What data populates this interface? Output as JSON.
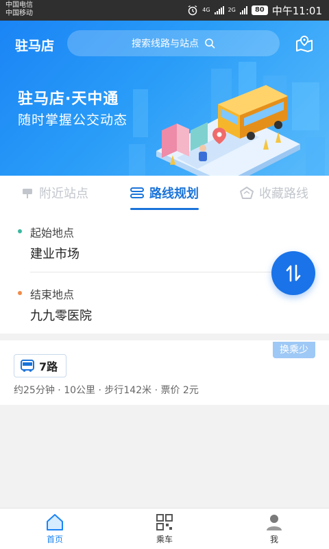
{
  "status_bar": {
    "carrier1": "中国电信",
    "carrier2": "中国移动",
    "signal1": "4G",
    "signal2": "2G",
    "battery": "80",
    "time": "中午11:01"
  },
  "header": {
    "city": "驻马店",
    "search_placeholder": "搜索线路与站点"
  },
  "hero": {
    "slogan_title": "驻马店·天中通",
    "slogan_subtitle": "随时掌握公交动态"
  },
  "tabs": [
    {
      "label": "附近站点",
      "icon": "signboard-icon"
    },
    {
      "label": "路线规划",
      "icon": "route-icon"
    },
    {
      "label": "收藏路线",
      "icon": "star-icon"
    }
  ],
  "route_form": {
    "start_label": "起始地点",
    "start_value": "建业市场",
    "end_label": "结束地点",
    "end_value": "九九零医院",
    "start_dot_color": "#3bb7a0",
    "end_dot_color": "#f08a48"
  },
  "result": {
    "tag": "换乘少",
    "route_name": "7路",
    "duration": "约25分钟",
    "distance": "10公里",
    "walk": "步行142米",
    "fare_label": "票价",
    "fare": "2元"
  },
  "bottom_nav": [
    {
      "label": "首页",
      "icon": "home-icon"
    },
    {
      "label": "乘车",
      "icon": "qr-code-icon"
    },
    {
      "label": "我",
      "icon": "user-icon"
    }
  ],
  "colors": {
    "primary": "#1a73d9",
    "hero": "#2a9df8"
  }
}
